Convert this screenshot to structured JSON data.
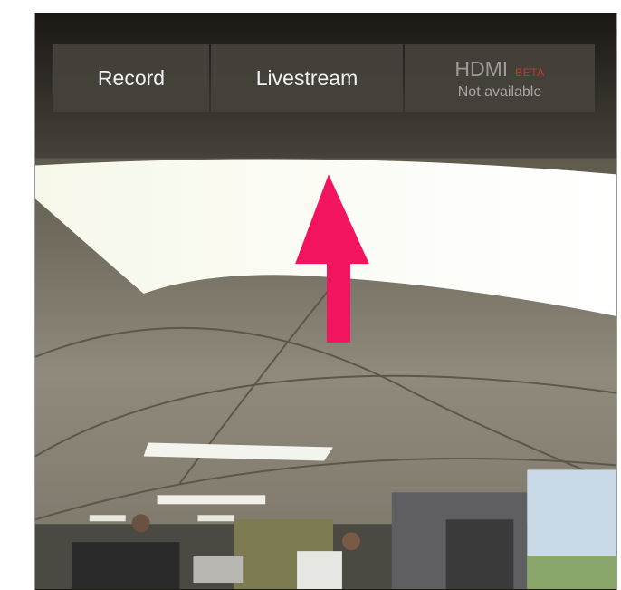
{
  "mode_bar": {
    "record_label": "Record",
    "livestream_label": "Livestream",
    "hdmi_label": "HDMI",
    "hdmi_badge": "BETA",
    "hdmi_status": "Not available"
  },
  "colors": {
    "arrow": "#f2145f",
    "badge": "#c0392b"
  }
}
